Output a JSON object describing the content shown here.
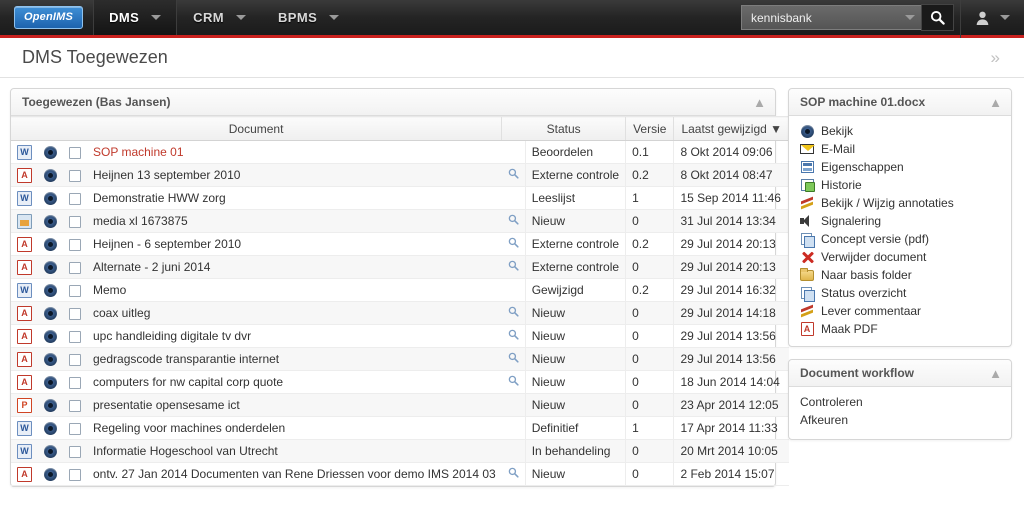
{
  "topnav": {
    "logo": "OpenIMS",
    "items": [
      {
        "label": "DMS",
        "active": true,
        "has_caret": true
      },
      {
        "label": "CRM",
        "active": false,
        "has_caret": true
      },
      {
        "label": "BPMS",
        "active": false,
        "has_caret": true
      }
    ],
    "search": {
      "value": "kennisbank",
      "placeholder": "kennisbank",
      "icon": "search-icon"
    },
    "user": {
      "icon": "user-icon",
      "caret": "chevron-down-icon"
    }
  },
  "page": {
    "title": "DMS Toegewezen",
    "expand_label": "»"
  },
  "assigned_panel": {
    "title": "Toegewezen (Bas Jansen)",
    "collapse_icon": "chevron-up-icon",
    "columns": [
      "Document",
      "Status",
      "Versie",
      "Laatst gewijzigd ▼"
    ],
    "sort_column": "Laatst gewijzigd",
    "sort_direction": "desc",
    "rows": [
      {
        "filetype": "word",
        "name": "SOP machine 01",
        "highlight": true,
        "magnifier": false,
        "status": "Beoordelen",
        "version": "0.1",
        "modified": "8 Okt 2014 09:06"
      },
      {
        "filetype": "pdf",
        "name": "Heijnen 13 september 2010",
        "highlight": false,
        "magnifier": true,
        "status": "Externe controle",
        "version": "0.2",
        "modified": "8 Okt 2014 08:47"
      },
      {
        "filetype": "word",
        "name": "Demonstratie HWW zorg",
        "highlight": false,
        "magnifier": false,
        "status": "Leeslijst",
        "version": "1",
        "modified": "15 Sep 2014 11:46"
      },
      {
        "filetype": "img",
        "name": "media xl 1673875",
        "highlight": false,
        "magnifier": true,
        "status": "Nieuw",
        "version": "0",
        "modified": "31 Jul 2014 13:34"
      },
      {
        "filetype": "pdf",
        "name": "Heijnen - 6 september 2010",
        "highlight": false,
        "magnifier": true,
        "status": "Externe controle",
        "version": "0.2",
        "modified": "29 Jul 2014 20:13"
      },
      {
        "filetype": "pdf",
        "name": "Alternate - 2 juni 2014",
        "highlight": false,
        "magnifier": true,
        "status": "Externe controle",
        "version": "0",
        "modified": "29 Jul 2014 20:13"
      },
      {
        "filetype": "word",
        "name": "Memo",
        "highlight": false,
        "magnifier": false,
        "status": "Gewijzigd",
        "version": "0.2",
        "modified": "29 Jul 2014 16:32"
      },
      {
        "filetype": "pdf",
        "name": "coax uitleg",
        "highlight": false,
        "magnifier": true,
        "status": "Nieuw",
        "version": "0",
        "modified": "29 Jul 2014 14:18"
      },
      {
        "filetype": "pdf",
        "name": "upc handleiding digitale tv dvr",
        "highlight": false,
        "magnifier": true,
        "status": "Nieuw",
        "version": "0",
        "modified": "29 Jul 2014 13:56"
      },
      {
        "filetype": "pdf",
        "name": "gedragscode transparantie internet",
        "highlight": false,
        "magnifier": true,
        "status": "Nieuw",
        "version": "0",
        "modified": "29 Jul 2014 13:56"
      },
      {
        "filetype": "pdf",
        "name": "computers for nw capital corp quote",
        "highlight": false,
        "magnifier": true,
        "status": "Nieuw",
        "version": "0",
        "modified": "18 Jun 2014 14:04"
      },
      {
        "filetype": "ppt",
        "name": "presentatie opensesame ict",
        "highlight": false,
        "magnifier": false,
        "status": "Nieuw",
        "version": "0",
        "modified": "23 Apr 2014 12:05"
      },
      {
        "filetype": "word",
        "name": "Regeling voor machines onderdelen",
        "highlight": false,
        "magnifier": false,
        "status": "Definitief",
        "version": "1",
        "modified": "17 Apr 2014 11:33"
      },
      {
        "filetype": "word",
        "name": "Informatie Hogeschool van Utrecht",
        "highlight": false,
        "magnifier": false,
        "status": "In behandeling",
        "version": "0",
        "modified": "20 Mrt 2014 10:05"
      },
      {
        "filetype": "pdf",
        "name": "ontv. 27 Jan 2014 Documenten van Rene Driessen voor demo IMS 2014 03",
        "highlight": false,
        "magnifier": true,
        "status": "Nieuw",
        "version": "0",
        "modified": "2 Feb 2014 15:07"
      }
    ]
  },
  "document_panel": {
    "title": "SOP machine 01.docx",
    "collapse_icon": "chevron-up-icon",
    "actions": [
      {
        "label": "Bekijk",
        "icon": "eye-icon"
      },
      {
        "label": "E-Mail",
        "icon": "envelope-icon"
      },
      {
        "label": "Eigenschappen",
        "icon": "properties-icon"
      },
      {
        "label": "Historie",
        "icon": "history-icon"
      },
      {
        "label": "Bekijk / Wijzig annotaties",
        "icon": "annotation-icon"
      },
      {
        "label": "Signalering",
        "icon": "speaker-icon"
      },
      {
        "label": "Concept versie (pdf)",
        "icon": "copy-icon"
      },
      {
        "label": "Verwijder document",
        "icon": "delete-x-icon"
      },
      {
        "label": "Naar basis folder",
        "icon": "folder-icon"
      },
      {
        "label": "Status overzicht",
        "icon": "copy-icon"
      },
      {
        "label": "Lever commentaar",
        "icon": "annotation-icon"
      },
      {
        "label": "Maak PDF",
        "icon": "pdf-icon"
      }
    ]
  },
  "workflow_panel": {
    "title": "Document workflow",
    "collapse_icon": "chevron-up-icon",
    "items": [
      {
        "label": "Controleren"
      },
      {
        "label": "Afkeuren"
      }
    ]
  },
  "colors": {
    "accent_red": "#c9211e",
    "link_red": "#c0392b",
    "nav_dark": "#242424",
    "logo_blue": "#1d63ad"
  }
}
